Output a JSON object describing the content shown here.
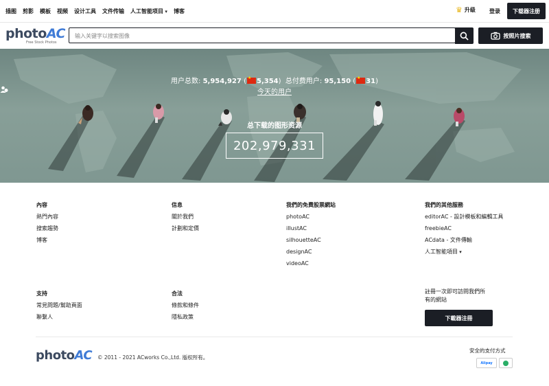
{
  "nav": {
    "links": [
      "插图",
      "剪影",
      "模板",
      "视频",
      "设计工具",
      "文件传输",
      "人工智能项目"
    ],
    "dropdown_link": "人工智能项目",
    "blog": "博客",
    "upgrade": "升级",
    "login": "登录",
    "register": "下载器注册"
  },
  "logo": {
    "text_photo": "photo",
    "text_ac": "AC",
    "tagline": "Free Stock Photos"
  },
  "search": {
    "placeholder": "输入关键字以搜索图像",
    "image_search_label": "按照片搜索"
  },
  "hero": {
    "users_label": "用户总数:",
    "users_total": "5,954,927",
    "users_cn": "5,354",
    "paid_label": "总付费用户:",
    "paid_total": "95,150",
    "paid_cn": "31",
    "today_users": "今天的用户",
    "downloads_label": "总下载的图形资源",
    "downloads_total": "202,979,331"
  },
  "footer": {
    "content": {
      "heading": "內容",
      "items": [
        "熱門內容",
        "搜索趨勢",
        "博客"
      ]
    },
    "info": {
      "heading": "信息",
      "items": [
        "關於我們",
        "計劃和定價"
      ]
    },
    "free_sites": {
      "heading": "我們的免費股票網站",
      "items": [
        "photoAC",
        "illustAC",
        "silhouetteAC",
        "designAC",
        "videoAC"
      ]
    },
    "other_services": {
      "heading": "我們的其他服務",
      "items": [
        "editorAC - 設計模板和編輯工具",
        "freebieAC",
        "ACdata - 文件傳輸",
        "人工智能項目"
      ]
    },
    "support": {
      "heading": "支持",
      "items": [
        "常見問題/幫助頁面",
        "聯繫人"
      ]
    },
    "legal": {
      "heading": "合法",
      "items": [
        "條款和條件",
        "隱私政策"
      ]
    },
    "register_note_line1": "註冊一次即可訪問我們所",
    "register_note_line2": "有的網站",
    "register_button": "下載器注冊",
    "logo_photo": "photo",
    "logo_ac": "AC",
    "copyright": "© 2011 - 2021 ACworks Co.,Ltd. 版权所有。",
    "payment_title": "安全的支付方式",
    "alipay": "Alipay"
  },
  "colors": {
    "dark": "#1b1e25",
    "accent": "#3f7bd6",
    "hero": "#7f9791"
  }
}
